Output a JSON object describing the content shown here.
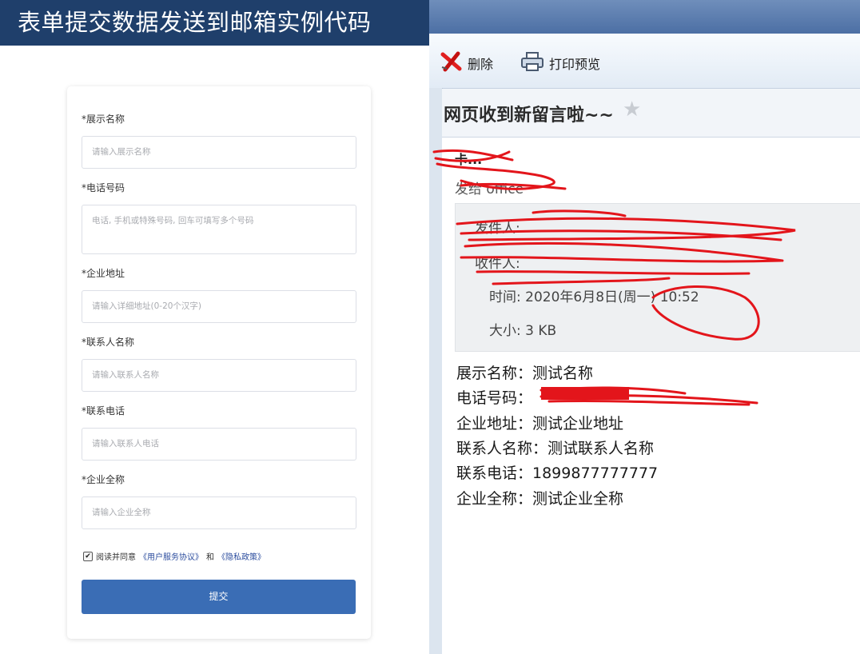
{
  "banner": {
    "title": "表单提交数据发送到邮箱实例代码"
  },
  "form": {
    "fields": [
      {
        "label": "*展示名称",
        "placeholder": "请输入展示名称"
      },
      {
        "label": "*电话号码",
        "placeholder": "电话, 手机或特殊号码, 回车可填写多个号码"
      },
      {
        "label": "*企业地址",
        "placeholder": "请输入详细地址(0-20个汉字)"
      },
      {
        "label": "*联系人名称",
        "placeholder": "请输入联系人名称"
      },
      {
        "label": "*联系电话",
        "placeholder": "请输入联系人电话"
      },
      {
        "label": "*企业全称",
        "placeholder": "请输入企业全称"
      }
    ],
    "agree": {
      "checked": true,
      "prefix": "阅读并同意",
      "link1": "《用户服务协议》",
      "middle": "和",
      "link2": "《隐私政策》"
    },
    "submit_label": "提交"
  },
  "mail": {
    "toolbar": {
      "delete_label": "删除",
      "print_label": "打印预览"
    },
    "subject": "网页收到新留言啦~~",
    "sender_partial": "卡...",
    "to_line": "发给 office",
    "meta": {
      "from_prefix": "发件人:",
      "to_prefix": "收件人:",
      "time": "时间: 2020年6月8日(周一) 10:52",
      "size": "大小: 3 KB"
    },
    "content": [
      "展示名称：测试名称",
      "电话号码：",
      "企业地址：测试企业地址",
      "联系人名称：测试联系人名称",
      "联系电话：1899877777777",
      "企业全称：测试企业全称"
    ]
  },
  "colors": {
    "banner": "#1f3f6b",
    "submit": "#3a6db5",
    "link": "#2c4d9e",
    "redaction": "#e3151b"
  },
  "icons": {
    "delete": "red-x-icon",
    "print": "printer-icon",
    "star": "star-icon"
  }
}
